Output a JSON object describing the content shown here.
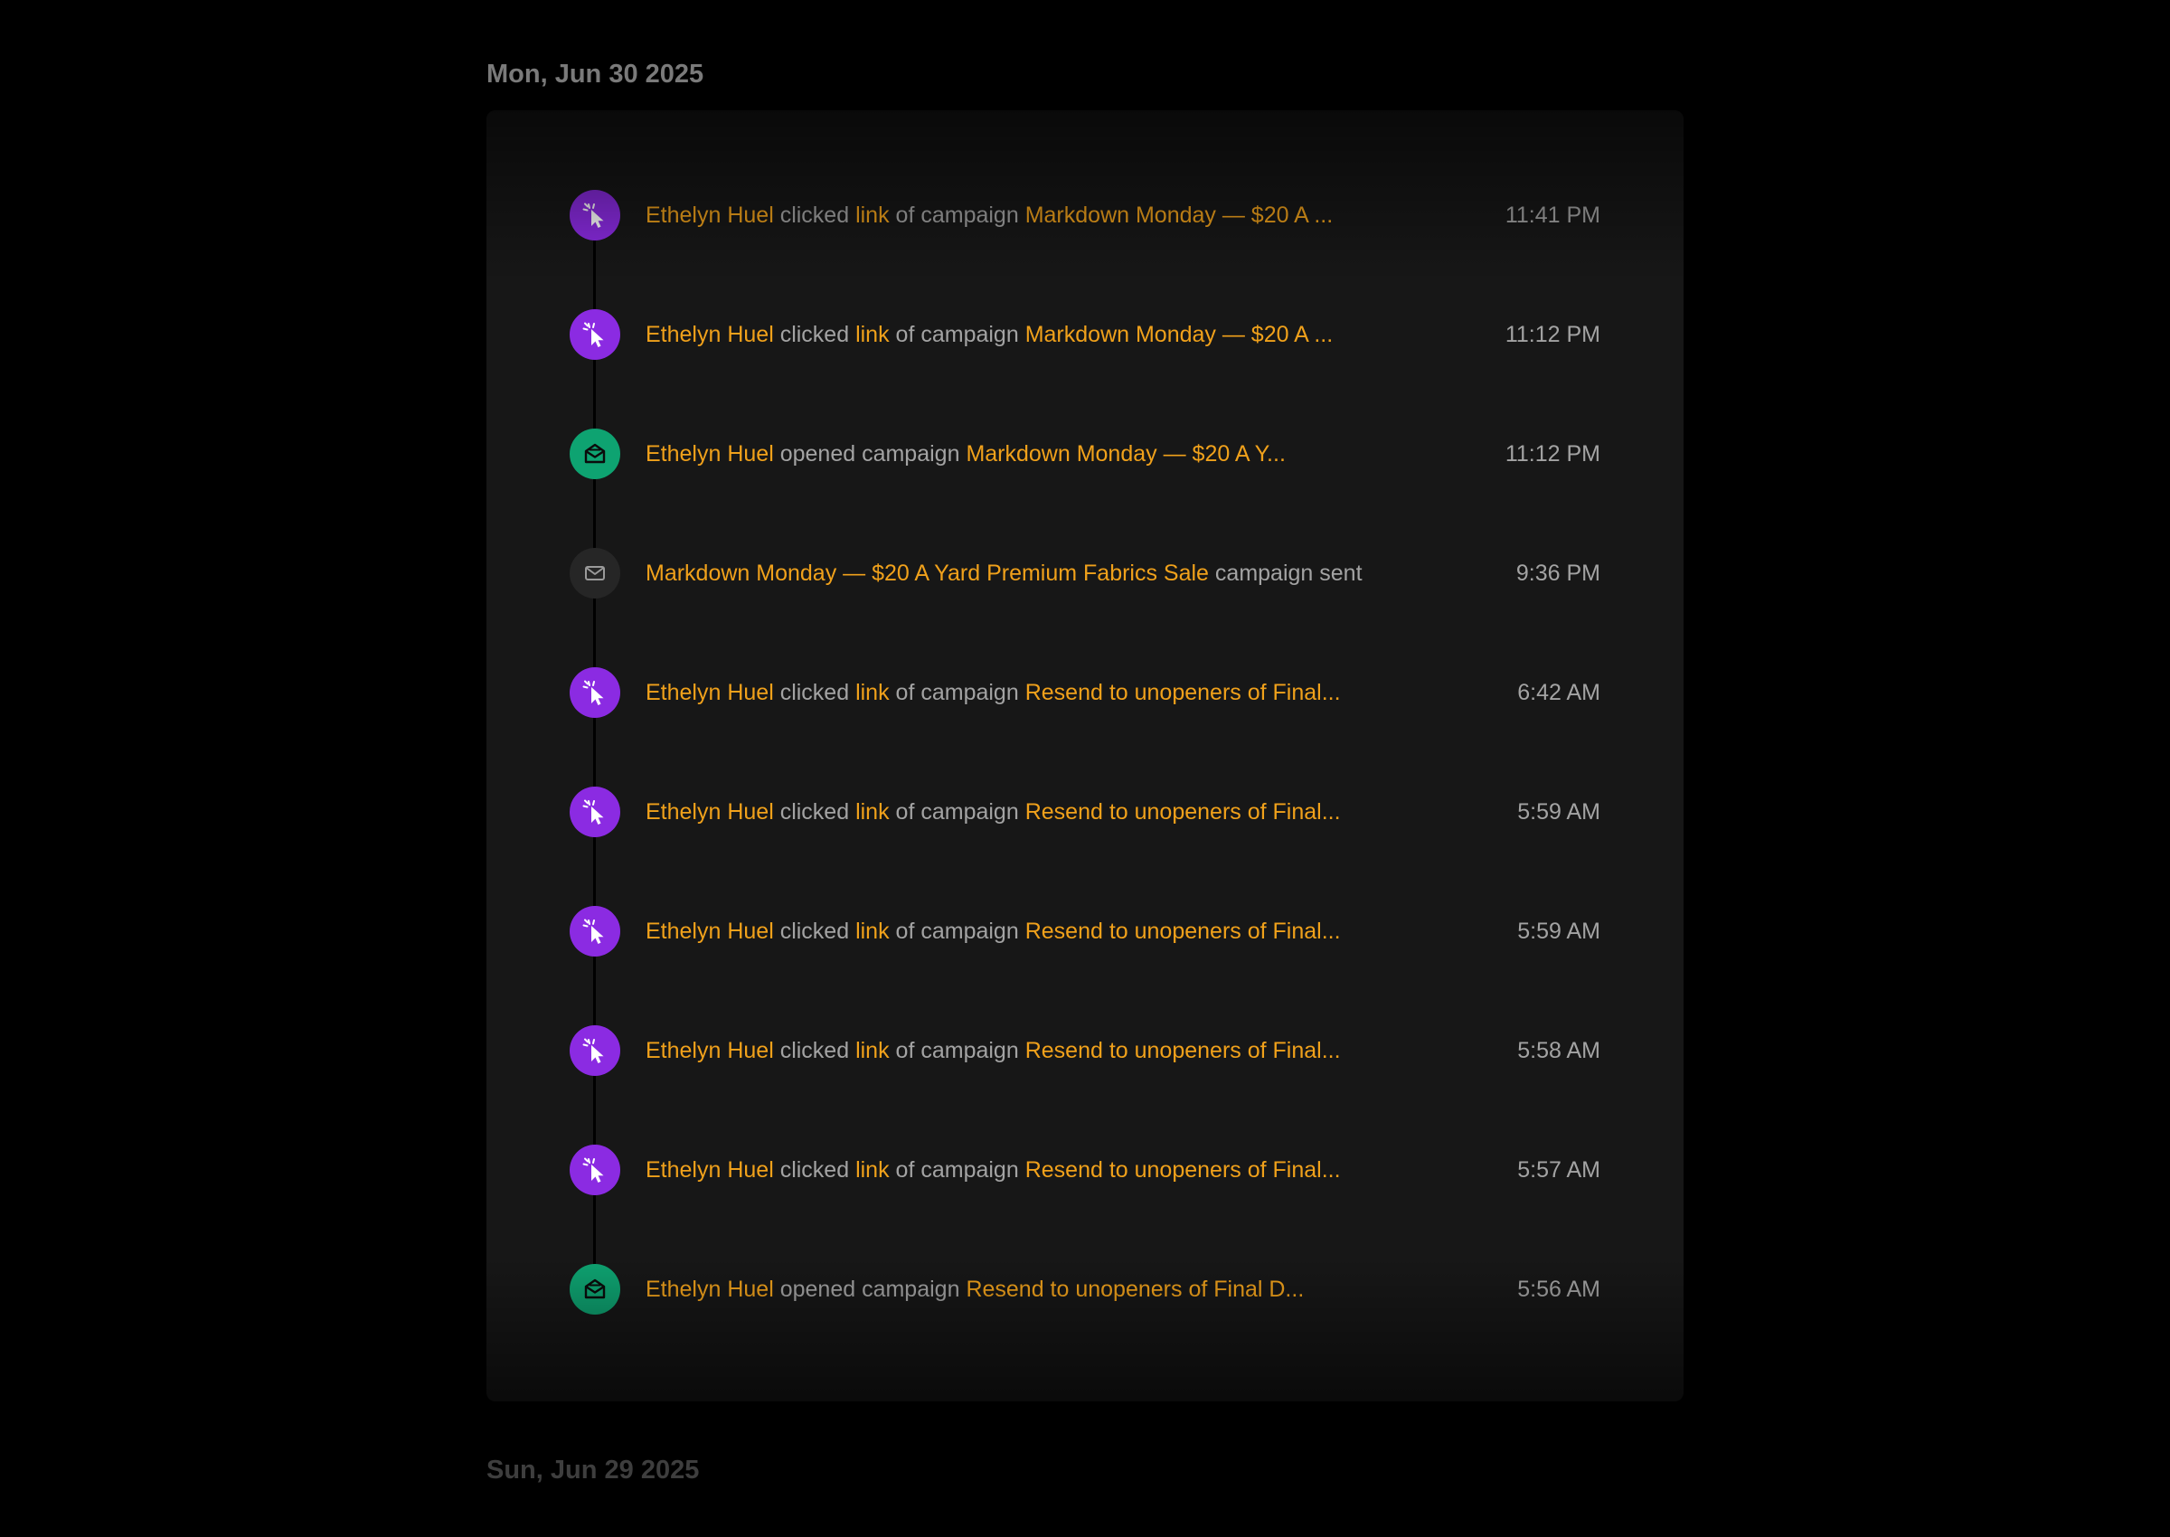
{
  "days": [
    {
      "label": "Mon, Jun 30 2025"
    },
    {
      "label": "Sun, Jun 29 2025"
    }
  ],
  "events": [
    {
      "icon": "cursor-click-icon",
      "kind": "click",
      "actor": "Ethelyn Huel",
      "verb1": "clicked",
      "link": "link",
      "verb2": "of campaign",
      "campaign": "Markdown Monday — $20 A ...",
      "time": "11:41 PM"
    },
    {
      "icon": "cursor-click-icon",
      "kind": "click",
      "actor": "Ethelyn Huel",
      "verb1": "clicked",
      "link": "link",
      "verb2": "of campaign",
      "campaign": "Markdown Monday — $20 A ...",
      "time": "11:12 PM"
    },
    {
      "icon": "envelope-open-icon",
      "kind": "open",
      "actor": "Ethelyn Huel",
      "verb": "opened campaign",
      "campaign": "Markdown Monday — $20 A Y...",
      "time": "11:12 PM"
    },
    {
      "icon": "envelope-icon",
      "kind": "sent",
      "campaign": "Markdown Monday — $20 A Yard Premium Fabrics Sale",
      "suffix": "campaign sent",
      "time": "9:36 PM"
    },
    {
      "icon": "cursor-click-icon",
      "kind": "click",
      "actor": "Ethelyn Huel",
      "verb1": "clicked",
      "link": "link",
      "verb2": "of campaign",
      "campaign": "Resend to unopeners of Final...",
      "time": "6:42 AM"
    },
    {
      "icon": "cursor-click-icon",
      "kind": "click",
      "actor": "Ethelyn Huel",
      "verb1": "clicked",
      "link": "link",
      "verb2": "of campaign",
      "campaign": "Resend to unopeners of Final...",
      "time": "5:59 AM"
    },
    {
      "icon": "cursor-click-icon",
      "kind": "click",
      "actor": "Ethelyn Huel",
      "verb1": "clicked",
      "link": "link",
      "verb2": "of campaign",
      "campaign": "Resend to unopeners of Final...",
      "time": "5:59 AM"
    },
    {
      "icon": "cursor-click-icon",
      "kind": "click",
      "actor": "Ethelyn Huel",
      "verb1": "clicked",
      "link": "link",
      "verb2": "of campaign",
      "campaign": "Resend to unopeners of Final...",
      "time": "5:58 AM"
    },
    {
      "icon": "cursor-click-icon",
      "kind": "click",
      "actor": "Ethelyn Huel",
      "verb1": "clicked",
      "link": "link",
      "verb2": "of campaign",
      "campaign": "Resend to unopeners of Final...",
      "time": "5:57 AM"
    },
    {
      "icon": "envelope-open-icon",
      "kind": "open",
      "actor": "Ethelyn Huel",
      "verb": "opened campaign",
      "campaign": "Resend to unopeners of Final D...",
      "time": "5:56 AM"
    }
  ],
  "colors": {
    "background": "#000000",
    "card": "#171717",
    "highlight": "#f0a11b",
    "muted_text": "#a3a3a3",
    "click_badge": "#8b2be2",
    "open_badge": "#0ea371",
    "sent_badge": "#262626"
  }
}
